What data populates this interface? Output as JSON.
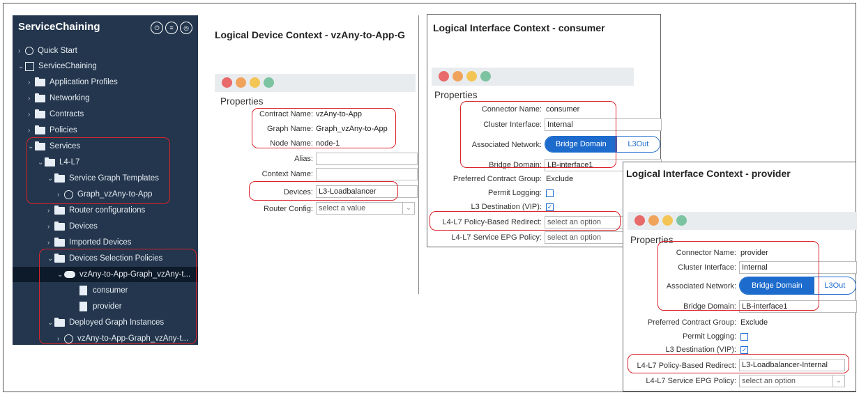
{
  "sidebar": {
    "title": "ServiceChaining",
    "header_icons": [
      "power-icon",
      "sidebar-view-icon",
      "refresh-icon"
    ],
    "items": [
      "Quick Start",
      "ServiceChaining",
      "Application Profiles",
      "Networking",
      "Contracts",
      "Policies",
      "Services",
      "L4-L7",
      "Service Graph Templates",
      "Graph_vzAny-to-App",
      "Router configurations",
      "Devices",
      "Imported Devices",
      "Devices Selection Policies",
      "vzAny-to-App-Graph_vzAny-t...",
      "consumer",
      "provider",
      "Deployed Graph Instances",
      "vzAny-to-App-Graph_vzAny-t..."
    ]
  },
  "device_ctx": {
    "title": "Logical Device Context - vzAny-to-App-G",
    "properties": "Properties",
    "labels": {
      "contract": "Contract Name:",
      "graph": "Graph Name:",
      "node": "Node Name:",
      "alias": "Alias:",
      "context": "Context Name:",
      "devices": "Devices:",
      "router": "Router Config:"
    },
    "values": {
      "contract": "vzAny-to-App",
      "graph": "Graph_vzAny-to-App",
      "node": "node-1",
      "devices": "L3-Loadbalancer",
      "router": "select a value"
    }
  },
  "consumer": {
    "title": "Logical Interface Context - consumer",
    "properties": "Properties",
    "labels": {
      "connector": "Connector Name:",
      "cluster": "Cluster Interface:",
      "network": "Associated Network:",
      "bd": "Bridge Domain:",
      "pcg": "Preferred Contract Group:",
      "permit": "Permit Logging:",
      "l3": "L3 Destination (VIP):",
      "pbr": "L4-L7 Policy-Based Redirect:",
      "epg": "L4-L7 Service EPG Policy:"
    },
    "values": {
      "connector": "consumer",
      "cluster": "Internal",
      "net_on": "Bridge Domain",
      "net_off": "L3Out",
      "bd": "LB-interface1",
      "pcg": "Exclude",
      "pbr": "select an option",
      "epg": "select an option"
    }
  },
  "provider": {
    "title": "Logical Interface Context - provider",
    "properties": "Properties",
    "labels": {
      "connector": "Connector Name:",
      "cluster": "Cluster Interface:",
      "network": "Associated Network:",
      "bd": "Bridge Domain:",
      "pcg": "Preferred Contract Group:",
      "permit": "Permit Logging:",
      "l3": "L3 Destination (VIP):",
      "pbr": "L4-L7 Policy-Based Redirect:",
      "epg": "L4-L7 Service EPG Policy:"
    },
    "values": {
      "connector": "provider",
      "cluster": "Internal",
      "net_on": "Bridge Domain",
      "net_off": "L3Out",
      "bd": "LB-interface1",
      "pcg": "Exclude",
      "pbr": "L3-Loadbalancer-Internal",
      "epg": "select an option"
    }
  },
  "colors": {
    "sidebar": "#23364d",
    "accent": "#1d6bcc",
    "highlight": "#d9232b",
    "tb_red": "#e86a6a",
    "tb_orange": "#f0a35a",
    "tb_yellow": "#f3c555",
    "tb_green": "#7cc3a2"
  }
}
